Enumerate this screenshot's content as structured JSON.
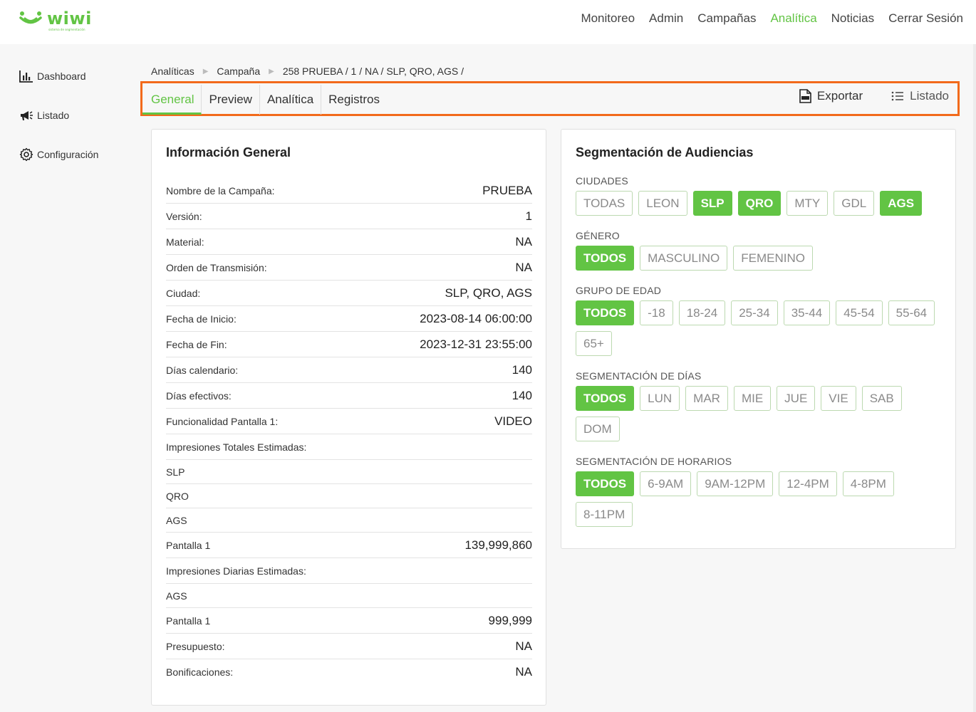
{
  "brand": {
    "name": "wiwi",
    "tagline": "sistema de segmentación",
    "accent": "#62c444",
    "highlight": "#f26a1b"
  },
  "topnav": [
    {
      "label": "Monitoreo",
      "active": false
    },
    {
      "label": "Admin",
      "active": false
    },
    {
      "label": "Campañas",
      "active": false
    },
    {
      "label": "Analítica",
      "active": true
    },
    {
      "label": "Noticias",
      "active": false
    },
    {
      "label": "Cerrar Sesión",
      "active": false
    }
  ],
  "sidebar": {
    "items": [
      {
        "label": "Dashboard",
        "icon": "bar-chart-icon"
      },
      {
        "label": "Listado",
        "icon": "megaphone-icon"
      },
      {
        "label": "Configuración",
        "icon": "gear-icon"
      }
    ]
  },
  "breadcrumb": [
    "Analíticas",
    "Campaña",
    "258 PRUEBA / 1 / NA / SLP, QRO, AGS /"
  ],
  "tabs": {
    "items": [
      {
        "label": "General",
        "active": true
      },
      {
        "label": "Preview",
        "active": false
      },
      {
        "label": "Analítica",
        "active": false
      },
      {
        "label": "Registros",
        "active": false
      }
    ],
    "export_label": "Exportar",
    "list_label": "Listado"
  },
  "info": {
    "title": "Información General",
    "rows": [
      {
        "key": "Nombre de la Campaña:",
        "value": "PRUEBA"
      },
      {
        "key": "Versión:",
        "value": "1"
      },
      {
        "key": "Material:",
        "value": "NA"
      },
      {
        "key": "Orden de Transmisión:",
        "value": "NA"
      },
      {
        "key": "Ciudad:",
        "value": "SLP, QRO, AGS"
      },
      {
        "key": "Fecha de Inicio:",
        "value": "2023-08-14 06:00:00"
      },
      {
        "key": "Fecha de Fin:",
        "value": "2023-12-31 23:55:00"
      },
      {
        "key": "Días calendario:",
        "value": "140"
      },
      {
        "key": "Días efectivos:",
        "value": "140"
      },
      {
        "key": "Funcionalidad Pantalla 1:",
        "value": "VIDEO"
      },
      {
        "key": "Impresiones Totales Estimadas:",
        "value": ""
      },
      {
        "key": "SLP",
        "value": ""
      },
      {
        "key": "QRO",
        "value": ""
      },
      {
        "key": "AGS",
        "value": ""
      },
      {
        "key": "Pantalla 1",
        "value": "139,999,860"
      },
      {
        "key": "Impresiones Diarias Estimadas:",
        "value": ""
      },
      {
        "key": "AGS",
        "value": ""
      },
      {
        "key": "Pantalla 1",
        "value": "999,999"
      },
      {
        "key": "Presupuesto:",
        "value": "NA"
      },
      {
        "key": "Bonificaciones:",
        "value": "NA"
      }
    ]
  },
  "segmentation": {
    "title": "Segmentación de Audiencias",
    "groups": [
      {
        "label": "CIUDADES",
        "options": [
          {
            "label": "TODAS",
            "selected": false
          },
          {
            "label": "LEON",
            "selected": false
          },
          {
            "label": "SLP",
            "selected": true
          },
          {
            "label": "QRO",
            "selected": true
          },
          {
            "label": "MTY",
            "selected": false
          },
          {
            "label": "GDL",
            "selected": false
          },
          {
            "label": "AGS",
            "selected": true
          }
        ]
      },
      {
        "label": "GÉNERO",
        "options": [
          {
            "label": "TODOS",
            "selected": true
          },
          {
            "label": "MASCULINO",
            "selected": false
          },
          {
            "label": "FEMENINO",
            "selected": false
          }
        ]
      },
      {
        "label": "GRUPO DE EDAD",
        "options": [
          {
            "label": "TODOS",
            "selected": true
          },
          {
            "label": "-18",
            "selected": false
          },
          {
            "label": "18-24",
            "selected": false
          },
          {
            "label": "25-34",
            "selected": false
          },
          {
            "label": "35-44",
            "selected": false
          },
          {
            "label": "45-54",
            "selected": false
          },
          {
            "label": "55-64",
            "selected": false
          },
          {
            "label": "65+",
            "selected": false
          }
        ]
      },
      {
        "label": "SEGMENTACIÓN DE DÍAS",
        "options": [
          {
            "label": "TODOS",
            "selected": true
          },
          {
            "label": "LUN",
            "selected": false
          },
          {
            "label": "MAR",
            "selected": false
          },
          {
            "label": "MIE",
            "selected": false
          },
          {
            "label": "JUE",
            "selected": false
          },
          {
            "label": "VIE",
            "selected": false
          },
          {
            "label": "SAB",
            "selected": false
          },
          {
            "label": "DOM",
            "selected": false
          }
        ]
      },
      {
        "label": "SEGMENTACIÓN DE HORARIOS",
        "options": [
          {
            "label": "TODOS",
            "selected": true
          },
          {
            "label": "6-9AM",
            "selected": false
          },
          {
            "label": "9AM-12PM",
            "selected": false
          },
          {
            "label": "12-4PM",
            "selected": false
          },
          {
            "label": "4-8PM",
            "selected": false
          },
          {
            "label": "8-11PM",
            "selected": false
          }
        ]
      }
    ]
  }
}
